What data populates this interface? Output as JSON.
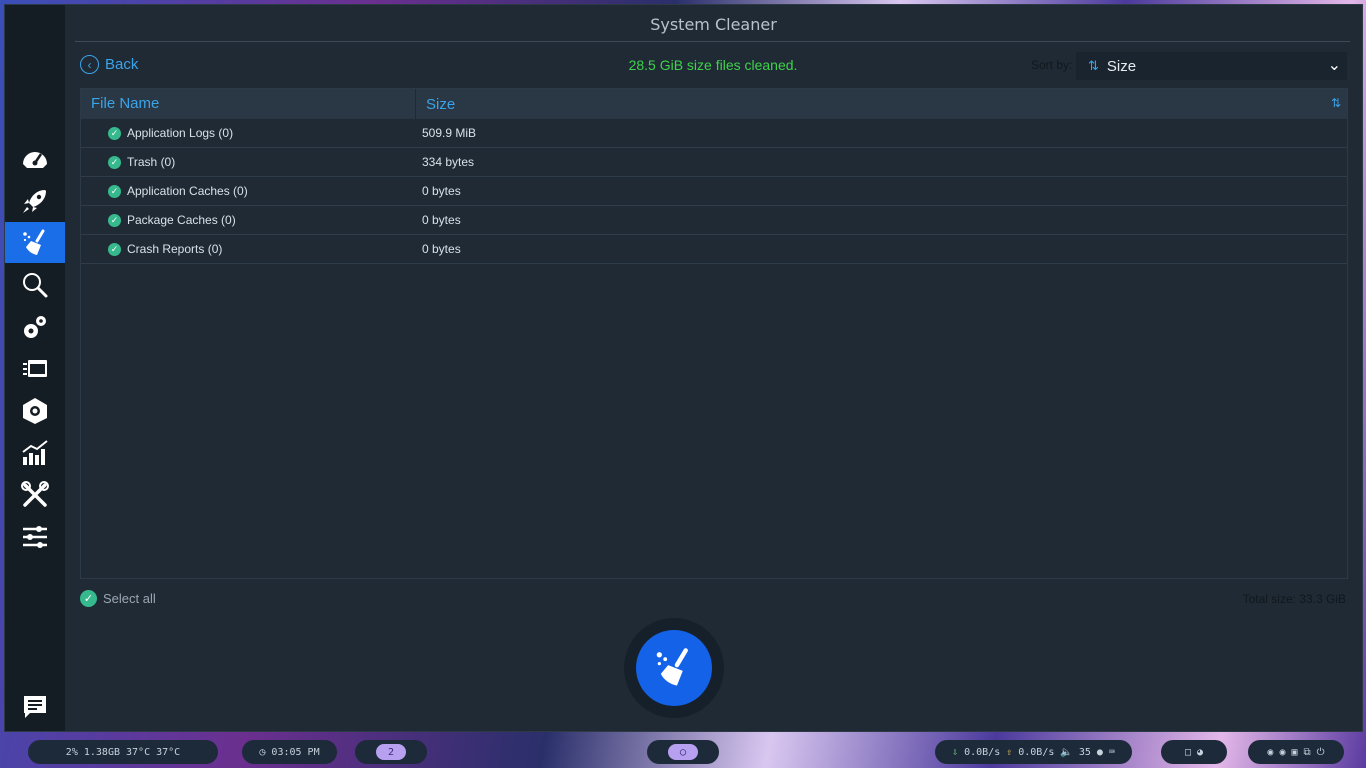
{
  "window": {
    "title": "System Cleaner"
  },
  "sidebar": {
    "items": [
      {
        "name": "dashboard",
        "icon": "speedometer-icon",
        "active": false
      },
      {
        "name": "startup",
        "icon": "rocket-icon",
        "active": false
      },
      {
        "name": "cleaner",
        "icon": "broom-icon",
        "active": true
      },
      {
        "name": "search",
        "icon": "magnifier-icon",
        "active": false
      },
      {
        "name": "services",
        "icon": "gears-icon",
        "active": false
      },
      {
        "name": "processes",
        "icon": "stack-icon",
        "active": false
      },
      {
        "name": "uninstaller",
        "icon": "package-icon",
        "active": false
      },
      {
        "name": "resources",
        "icon": "bar-chart-icon",
        "active": false
      },
      {
        "name": "helpers",
        "icon": "tools-icon",
        "active": false
      },
      {
        "name": "settings",
        "icon": "sliders-icon",
        "active": false
      },
      {
        "name": "feedback",
        "icon": "chat-icon",
        "active": false
      }
    ]
  },
  "toolbar": {
    "back_label": "Back",
    "status_message": "28.5 GiB size files cleaned.",
    "sort_label": "Sort by:",
    "sort_value": "Size"
  },
  "table": {
    "columns": [
      "File Name",
      "Size"
    ],
    "rows": [
      {
        "name": "Application Logs (0)",
        "size": "509.9 MiB"
      },
      {
        "name": "Trash (0)",
        "size": "334 bytes"
      },
      {
        "name": "Application Caches (0)",
        "size": "0 bytes"
      },
      {
        "name": "Package Caches (0)",
        "size": "0 bytes"
      },
      {
        "name": "Crash Reports (0)",
        "size": "0 bytes"
      }
    ]
  },
  "footer": {
    "select_all_label": "Select all",
    "total_size": "Total size: 33.3 GiB"
  },
  "taskbar": {
    "system_stats": "2%  1.38GB  37°C  37°C",
    "clock": "03:05 PM",
    "workspace": "2",
    "net_down": "0.0B/s",
    "net_up": "0.0B/s",
    "volume": "35"
  },
  "colors": {
    "accent": "#1a6ee8",
    "link": "#3aa4ea",
    "success": "#3fd24b",
    "check": "#35b98d"
  }
}
